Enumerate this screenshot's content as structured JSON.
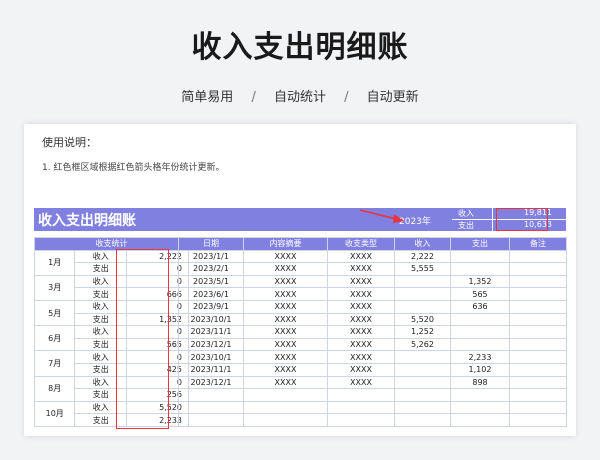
{
  "header": {
    "title": "收入支出明细账",
    "taglines": [
      "简单易用",
      "自动统计",
      "自动更新"
    ],
    "separator": "/"
  },
  "usage": {
    "title": "使用说明：",
    "line1": "1. 红色框区域根据红色箭头格年份统计更新。"
  },
  "banner": {
    "title": "收入支出明细账",
    "year": "2023年",
    "income_label": "收入",
    "income_value": "19,811",
    "expense_label": "支出",
    "expense_value": "10,633"
  },
  "summary_table": {
    "header": "收支统计",
    "months": [
      {
        "month": "1月",
        "income": "2,222",
        "expense": "0"
      },
      {
        "month": "3月",
        "income": "0",
        "expense": "666"
      },
      {
        "month": "5月",
        "income": "0",
        "expense": "1,352"
      },
      {
        "month": "6月",
        "income": "0",
        "expense": "565"
      },
      {
        "month": "7月",
        "income": "0",
        "expense": "425"
      },
      {
        "month": "8月",
        "income": "0",
        "expense": "256"
      },
      {
        "month": "10月",
        "income": "5,520",
        "expense": "2,233"
      }
    ],
    "income_label": "收入",
    "expense_label": "支出"
  },
  "detail_table": {
    "columns": [
      "日期",
      "内容摘要",
      "收支类型",
      "收入",
      "支出",
      "备注"
    ],
    "rows": [
      [
        "2023/1/1",
        "XXXX",
        "XXXX",
        "2,222",
        "",
        ""
      ],
      [
        "2023/2/1",
        "XXXX",
        "XXXX",
        "5,555",
        "",
        ""
      ],
      [
        "2023/5/1",
        "XXXX",
        "XXXX",
        "",
        "1,352",
        ""
      ],
      [
        "2023/6/1",
        "XXXX",
        "XXXX",
        "",
        "565",
        ""
      ],
      [
        "2023/9/1",
        "XXXX",
        "XXXX",
        "",
        "636",
        ""
      ],
      [
        "2023/10/1",
        "XXXX",
        "XXXX",
        "5,520",
        "",
        ""
      ],
      [
        "2023/11/1",
        "XXXX",
        "XXXX",
        "1,252",
        "",
        ""
      ],
      [
        "2023/12/1",
        "XXXX",
        "XXXX",
        "5,262",
        "",
        ""
      ],
      [
        "2023/10/1",
        "XXXX",
        "XXXX",
        "",
        "2,233",
        ""
      ],
      [
        "2023/11/1",
        "XXXX",
        "XXXX",
        "",
        "1,102",
        ""
      ],
      [
        "2023/12/1",
        "XXXX",
        "XXXX",
        "",
        "898",
        ""
      ],
      [
        "",
        "",
        "",
        "",
        "",
        ""
      ],
      [
        "",
        "",
        "",
        "",
        "",
        ""
      ],
      [
        "",
        "",
        "",
        "",
        "",
        ""
      ]
    ]
  },
  "colors": {
    "accent": "#8080e0",
    "highlight_box": "#e8343f"
  }
}
